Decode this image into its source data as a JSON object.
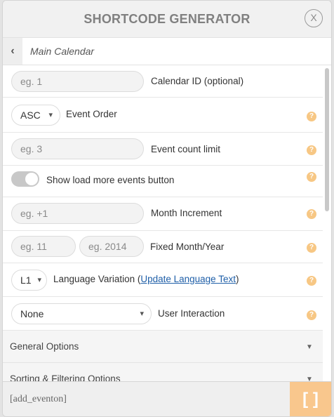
{
  "header": {
    "title": "SHORTCODE GENERATOR",
    "close_glyph": "X"
  },
  "breadcrumb": {
    "back_glyph": "‹",
    "title": "Main Calendar"
  },
  "fields": {
    "calendar_id": {
      "placeholder": "eg. 1",
      "label": "Calendar ID (optional)"
    },
    "event_order": {
      "value": "ASC",
      "label": "Event Order"
    },
    "event_count": {
      "placeholder": "eg. 3",
      "label": "Event count limit"
    },
    "load_more": {
      "label": "Show load more events button",
      "enabled": false
    },
    "month_increment": {
      "placeholder": "eg. +1",
      "label": "Month Increment"
    },
    "fixed_month": {
      "placeholder": "eg. 11"
    },
    "fixed_year": {
      "placeholder": "eg. 2014"
    },
    "fixed_label": "Fixed Month/Year",
    "language": {
      "value": "L1",
      "label_prefix": "Language Variation (",
      "link": "Update Language Text",
      "label_suffix": ")"
    },
    "user_interaction": {
      "value": "None",
      "label": "User Interaction"
    }
  },
  "help_glyph": "?",
  "sections": [
    {
      "label": "General Options"
    },
    {
      "label": "Sorting & Filtering Options"
    }
  ],
  "footer": {
    "shortcode": "[add_eventon]",
    "insert_glyph": "[ ]"
  },
  "colors": {
    "accent": "#f9c78d",
    "help": "#f7c784",
    "link": "#1f5fa8"
  }
}
